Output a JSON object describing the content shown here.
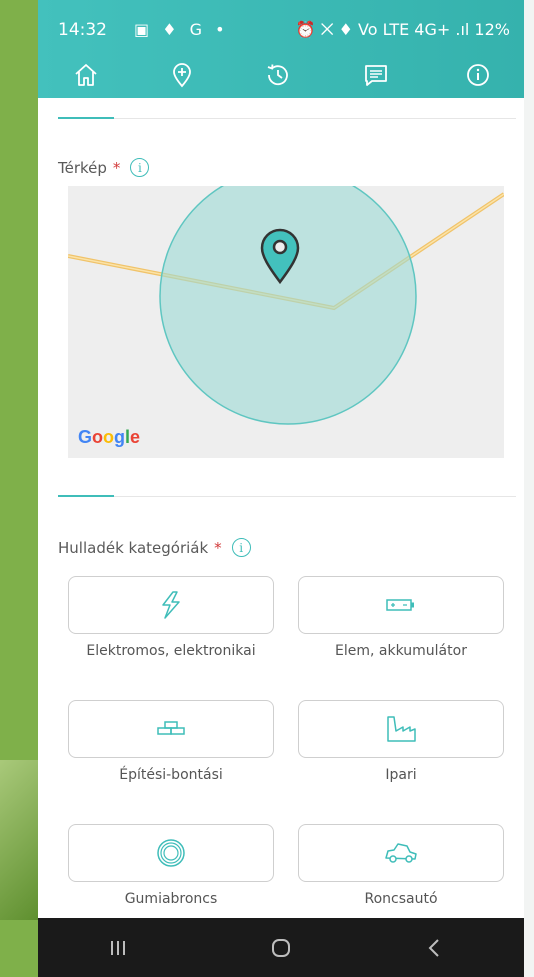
{
  "status_bar": {
    "time": "14:32",
    "left_icons": "▣ ♦ G •",
    "right_text": "⏰ ⨉ ♦ Vo LTE 4G+ .ıl 12%"
  },
  "nav": {
    "tabs": [
      {
        "icon": "home-icon"
      },
      {
        "icon": "location-add-icon"
      },
      {
        "icon": "history-icon"
      },
      {
        "icon": "message-icon"
      },
      {
        "icon": "info-icon"
      }
    ],
    "active_index": 1
  },
  "map_section": {
    "label": "Térkép",
    "required": "*",
    "info": "i",
    "map_attribution": "Google"
  },
  "categories_section": {
    "label": "Hulladék kategóriák",
    "required": "*",
    "info": "i",
    "items": [
      {
        "label": "Elektromos, elektronikai",
        "icon": "lightning-icon"
      },
      {
        "label": "Elem, akkumulátor",
        "icon": "battery-icon"
      },
      {
        "label": "Építési-bontási",
        "icon": "bricks-icon"
      },
      {
        "label": "Ipari",
        "icon": "factory-icon"
      },
      {
        "label": "Gumiabroncs",
        "icon": "tire-icon"
      },
      {
        "label": "Roncsautó",
        "icon": "wrecked-car-icon"
      }
    ]
  },
  "colors": {
    "accent": "#3fbdb9",
    "header": "#43c1bd",
    "required": "#d23a3a"
  }
}
